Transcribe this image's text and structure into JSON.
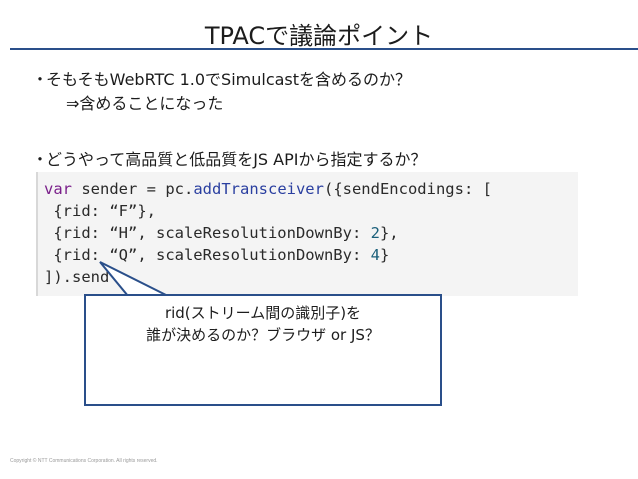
{
  "title": "TPACで議論ポイント",
  "bullets": [
    {
      "marker": "・",
      "text": "そもそもWebRTC 1.0でSimulcastを含めるのか？",
      "sub": "⇒含めることになった"
    },
    {
      "marker": "・",
      "text": "どうやって高品質と低品質をJS APIから指定するか？"
    }
  ],
  "code": {
    "line1_kw": "var",
    "line1_a": " sender = pc.",
    "line1_fn": "addTransceiver",
    "line1_b": "({sendEncodings: [",
    "line2": " {rid: “F”},",
    "line3_a": " {rid: “H”, scaleResolutionDownBy: ",
    "line3_num": "2",
    "line3_b": "},",
    "line4_a": " {rid: “Q”, scaleResolutionDownBy: ",
    "line4_num": "4",
    "line4_b": "}",
    "line5": "]).send"
  },
  "callout": {
    "line1": "rid(ストリーム間の識別子)を",
    "line2": "誰が決めるのか？ブラウザ or JS？"
  },
  "copyright": "Copyright   © NTT Communications   Corporation.   All rights reserved.",
  "colors": {
    "accent": "#2a4f8a",
    "code_bg": "#f4f4f4",
    "keyword": "#7a1f8a"
  }
}
